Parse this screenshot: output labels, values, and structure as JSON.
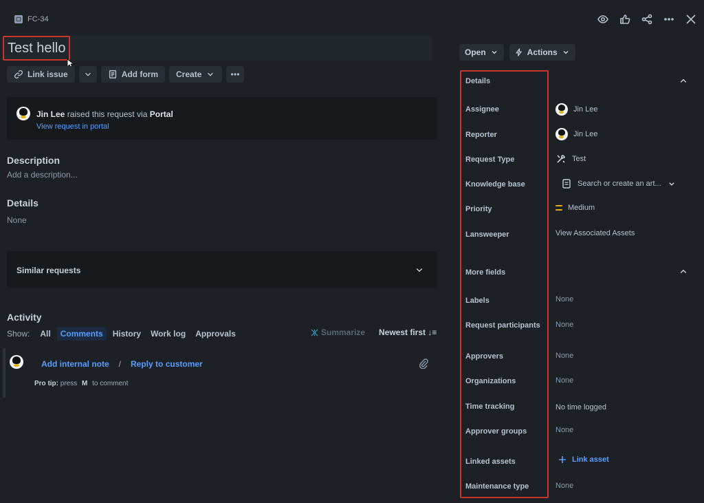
{
  "header": {
    "issue_key": "FC-34"
  },
  "issue": {
    "title": "Test hello"
  },
  "toolbar": {
    "link_issue": "Link issue",
    "add_form": "Add form",
    "create": "Create"
  },
  "raised": {
    "user": "Jin Lee",
    "text": "raised this request via",
    "channel": "Portal",
    "link": "View request in portal"
  },
  "description": {
    "heading": "Description",
    "placeholder": "Add a description..."
  },
  "details_main": {
    "heading": "Details",
    "value": "None"
  },
  "similar": {
    "label": "Similar requests"
  },
  "activity": {
    "heading": "Activity",
    "show_label": "Show:",
    "filters": [
      "All",
      "Comments",
      "History",
      "Work log",
      "Approvals"
    ],
    "active_filter": "Comments",
    "summarize": "Summarize",
    "sort": "Newest first",
    "add_internal_note": "Add internal note",
    "separator": "/",
    "reply_to_customer": "Reply to customer",
    "protip_label": "Pro tip:",
    "protip_press": "press",
    "protip_key": "M",
    "protip_suffix": "to comment"
  },
  "right": {
    "status_label": "Open",
    "actions_label": "Actions",
    "details_heading": "Details",
    "fields": [
      {
        "label": "Assignee",
        "value": "Jin Lee"
      },
      {
        "label": "Reporter",
        "value": "Jin Lee"
      },
      {
        "label": "Request Type",
        "value": "Test"
      },
      {
        "label": "Knowledge base",
        "value": "Search or create an art..."
      },
      {
        "label": "Priority",
        "value": "Medium"
      },
      {
        "label": "Lansweeper",
        "value": "View Associated Assets"
      }
    ],
    "more_heading": "More fields",
    "more_fields": [
      {
        "label": "Labels",
        "value": "None"
      },
      {
        "label": "Request participants",
        "value": "None"
      },
      {
        "label": "Approvers",
        "value": "None"
      },
      {
        "label": "Organizations",
        "value": "None"
      },
      {
        "label": "Time tracking",
        "value": "No time logged"
      },
      {
        "label": "Approver groups",
        "value": "None"
      },
      {
        "label": "Linked assets",
        "value": "Link asset"
      },
      {
        "label": "Maintenance type",
        "value": "None"
      }
    ]
  },
  "colors": {
    "accent": "#579dff",
    "highlight": "#c9372c",
    "priority": "#e2b203"
  }
}
